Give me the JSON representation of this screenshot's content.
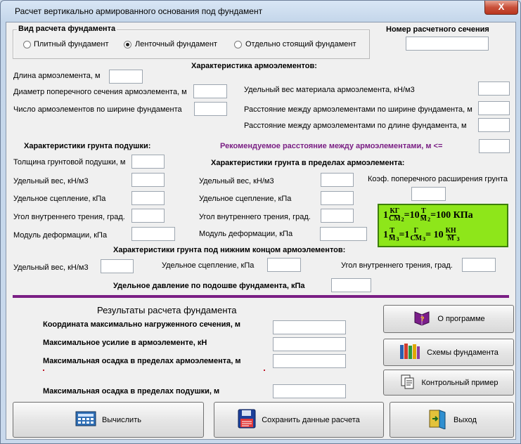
{
  "window": {
    "title": "Расчет вертикально армированного основания  под фундамент",
    "close_glyph": "X"
  },
  "foundation_type": {
    "group_label": "Вид расчета фундамента",
    "options": [
      "Плитный фундамент",
      "Ленточный фундамент",
      "Отдельно стоящий фундамент"
    ],
    "selected": "Ленточный фундамент"
  },
  "section_number": {
    "label": "Номер расчетного сечения",
    "value": ""
  },
  "reinforcement": {
    "heading": "Характеристика армоэлементов:",
    "length_label": "Длина армоэлемента, м",
    "diameter_label": "Диаметр поперечного сечения армоэлемента, м",
    "count_label": "Число армоэлементов по ширине фундамента",
    "unit_weight_label": "Удельный вес материала армоэлемента, кН/м3",
    "spacing_width_label": "Расстояние между армоэлементами по ширине фундамента, м",
    "spacing_length_label": "Расстояние между армоэлементами по длине фундамента, м",
    "recommended_label": "Рекомендуемое расстояние между армоэлементами, м  <="
  },
  "cushion_soil": {
    "heading": "Характеристики грунта подушки:",
    "thickness_label": "Толщина грунтовой подушки, м",
    "unit_weight_label": "Удельный вес, кН/м3",
    "cohesion_label": "Удельное  сцепление, кПа",
    "friction_label": "Угол внутреннего трения, град.",
    "modulus_label": "Модуль деформации, кПа"
  },
  "reinforced_soil": {
    "heading": "Характеристики грунта в пределах армоэлемента:",
    "unit_weight_label": "Удельный вес, кН/м3",
    "cohesion_label": "Удельное  сцепление, кПа",
    "friction_label": "Угол внутреннего трения, град.",
    "modulus_label": "Модуль деформации, кПа",
    "poisson_label": "Коэф. поперечного расширения грунта"
  },
  "formula": {
    "line1_lead": "1",
    "line1_frac1_num": "КГ",
    "line1_frac1_den": "СМ",
    "line1_frac1_exp": "2",
    "line1_mid": "=10",
    "line1_frac2_num": "Т",
    "line1_frac2_den": "М",
    "line1_frac2_exp": "2",
    "line1_tail": "=100 КПа",
    "line2_lead": "1",
    "line2_frac1_num": "Т",
    "line2_frac1_den": "М",
    "line2_frac1_exp": "3",
    "line2_mid": "=1",
    "line2_frac2_num": "Г",
    "line2_frac2_den": "СМ",
    "line2_frac2_exp": "3",
    "line2_tail": "= 10",
    "line2_frac3_num": "КН",
    "line2_frac3_den": "М",
    "line2_frac3_exp": "3"
  },
  "lower_soil": {
    "heading": "Характеристики грунта под нижним концом армоэлементов:",
    "unit_weight_label": "Удельный вес, кН/м3",
    "cohesion_label": "Удельное  сцепление, кПа",
    "friction_label": "Угол внутреннего трения, град."
  },
  "pressure": {
    "label": "Удельное давление по подошве фундамента, кПа"
  },
  "results": {
    "heading": "Результаты расчета фундамента",
    "coord_label": "Координата максимально нагруженного сечения, м",
    "force_label": "Максимальное усилие в армоэлементе, кН",
    "settle_rein_label": "Максимальная осадка в пределах армоэлемента, м",
    "settle_cushion_label": "Максимальная осадка в пределах подушки, м"
  },
  "buttons": {
    "about": "О программе",
    "schemes": "Схемы фундамента",
    "example": "Контрольный пример",
    "calculate": "Вычислить",
    "save": "Сохранить данные расчета",
    "exit": "Выход"
  },
  "icons": [
    "book-icon",
    "books-icon",
    "documents-icon",
    "calculator-icon",
    "floppy-disk-icon",
    "exit-door-icon"
  ]
}
